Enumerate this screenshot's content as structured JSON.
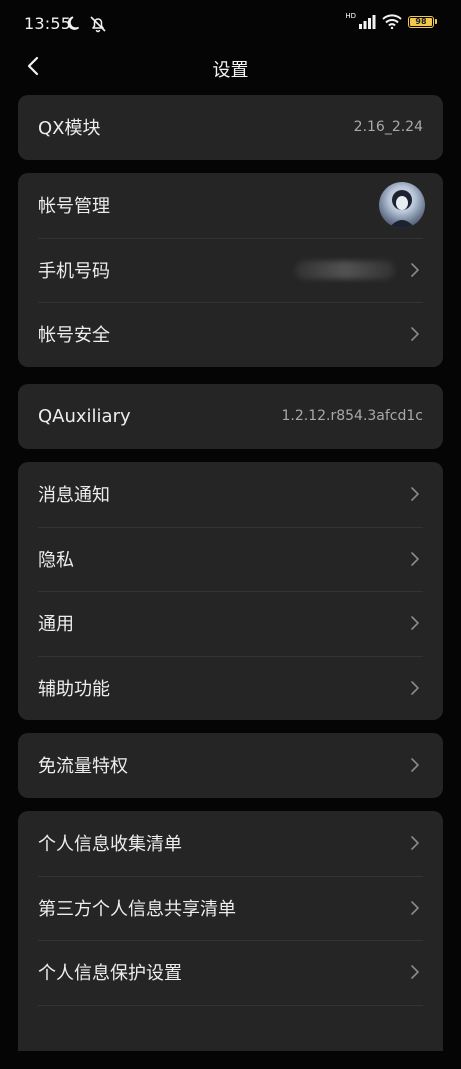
{
  "status_bar": {
    "time": "13:55",
    "hd_label": "HD",
    "battery_level": "98",
    "battery_fraction": 0.98
  },
  "header": {
    "title": "设置"
  },
  "card_qx": {
    "label": "QX模块",
    "value": "2.16_2.24"
  },
  "card_account": {
    "account_management": "帐号管理",
    "phone_number": "手机号码",
    "account_security": "帐号安全"
  },
  "card_qauxiliary": {
    "label": "QAuxiliary",
    "value": "1.2.12.r854.3afcd1c"
  },
  "card_general": {
    "notifications": "消息通知",
    "privacy": "隐私",
    "general": "通用",
    "accessibility": "辅助功能"
  },
  "card_data": {
    "free_data": "免流量特权"
  },
  "card_personal": {
    "collection_list": "个人信息收集清单",
    "third_party_list": "第三方个人信息共享清单",
    "protection_settings": "个人信息保护设置"
  },
  "icons": {
    "moon": "moon-icon",
    "mute": "mute-icon",
    "signal": "signal-icon",
    "wifi": "wifi-icon",
    "battery": "battery-icon",
    "back": "back-arrow-icon",
    "chevron": "chevron-right-icon"
  },
  "colors": {
    "background": "#050505",
    "card": "#252525",
    "battery": "#f2c94c"
  }
}
